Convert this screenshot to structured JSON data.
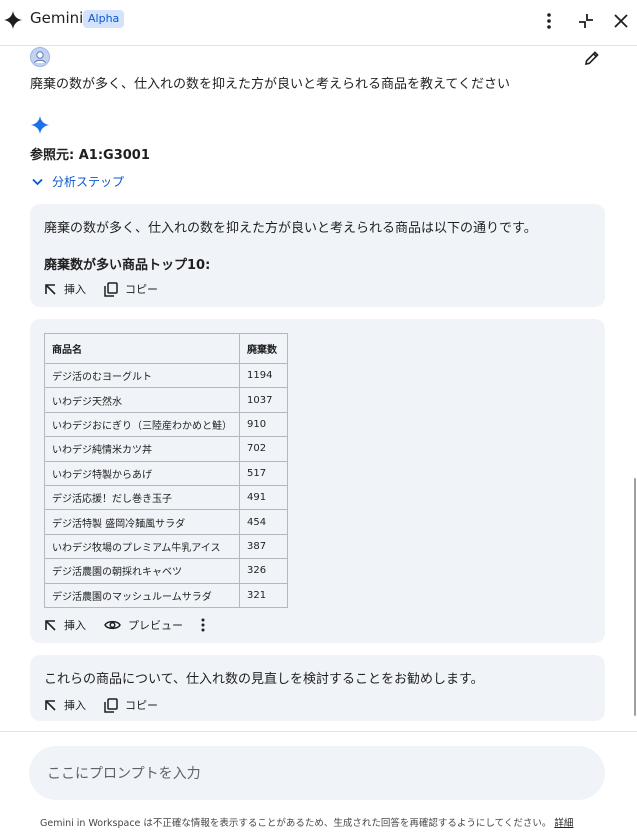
{
  "header": {
    "title": "Gemini",
    "badge": "Alpha"
  },
  "user_prompt": "廃棄の数が多く、仕入れの数を抑えた方が良いと考えられる商品を教えてください",
  "response": {
    "source": "参照元: A1:G3001",
    "analysis_steps": "分析ステップ",
    "card1": {
      "text": "廃棄の数が多く、仕入れの数を抑えた方が良いと考えられる商品は以下の通りです。",
      "heading": "廃棄数が多い商品トップ10:",
      "insert_label": "挿入",
      "copy_label": "コピー"
    },
    "table": {
      "headers": [
        "商品名",
        "廃棄数"
      ],
      "rows": [
        [
          "デジ活のむヨーグルト",
          "1194"
        ],
        [
          "いわデジ天然水",
          "1037"
        ],
        [
          "いわデジおにぎり（三陸産わかめと鮭）",
          "910"
        ],
        [
          "いわデジ純情米カツ丼",
          "702"
        ],
        [
          "いわデジ特製からあげ",
          "517"
        ],
        [
          "デジ活応援！だし巻き玉子",
          "491"
        ],
        [
          "デジ活特製 盛岡冷麺風サラダ",
          "454"
        ],
        [
          "いわデジ牧場のプレミアム牛乳アイス",
          "387"
        ],
        [
          "デジ活農園の朝採れキャベツ",
          "326"
        ],
        [
          "デジ活農園のマッシュルームサラダ",
          "321"
        ]
      ],
      "insert_label": "挿入",
      "preview_label": "プレビュー"
    },
    "card3": {
      "text": "これらの商品について、仕入れ数の見直しを検討することをお勧めします。",
      "insert_label": "挿入",
      "copy_label": "コピー"
    }
  },
  "input": {
    "placeholder": "ここにプロンプトを入力"
  },
  "footer": {
    "text": "Gemini in Workspace は不正確な情報を表示することがあるため、生成された回答を再確認するようにしてください。",
    "link": "詳細"
  },
  "colors": {
    "accent": "#0b57d0",
    "card_bg": "#f0f4f9",
    "badge_bg": "#d3e3fd"
  }
}
